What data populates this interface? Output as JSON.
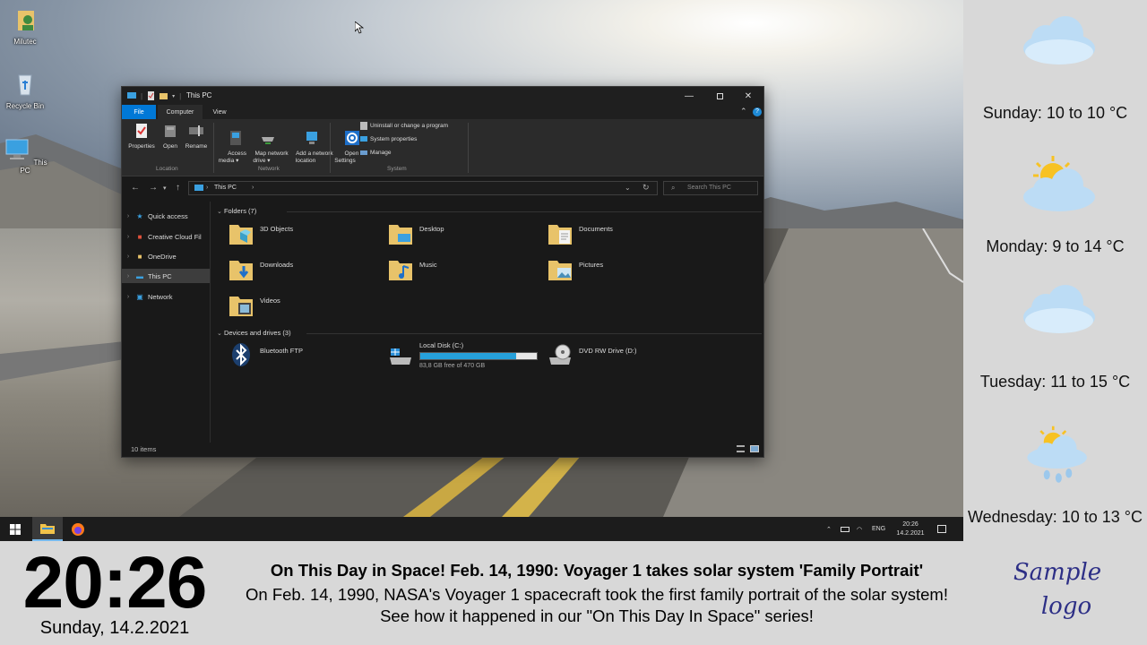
{
  "desktop": {
    "icons": [
      {
        "label": "Milutec",
        "icon": "user-folder-icon"
      },
      {
        "label": "Recycle Bin",
        "icon": "recycle-bin-icon"
      },
      {
        "label": "This PC",
        "icon": "computer-icon"
      }
    ]
  },
  "explorer": {
    "title": "This PC",
    "tabs": [
      "File",
      "Computer",
      "View"
    ],
    "ribbon": {
      "location": {
        "label": "Location",
        "buttons": [
          "Properties",
          "Open",
          "Rename"
        ]
      },
      "network": {
        "label": "Network",
        "buttons": [
          "Access\nmedia ▾",
          "Map network\ndrive ▾",
          "Add a network\nlocation"
        ]
      },
      "system": {
        "label": "System",
        "open_settings": "Open\nSettings",
        "small_buttons": [
          "Uninstall or change a program",
          "System properties",
          "Manage"
        ]
      }
    },
    "address": {
      "crumb": "This PC",
      "separator": "›",
      "search_placeholder": "Search This PC"
    },
    "nav": {
      "items": [
        "Quick access",
        "Creative Cloud Fil",
        "OneDrive",
        "This PC",
        "Network"
      ],
      "selected": "This PC"
    },
    "folders": {
      "header": "Folders (7)",
      "items": [
        "3D Objects",
        "Desktop",
        "Documents",
        "Downloads",
        "Music",
        "Pictures",
        "Videos"
      ]
    },
    "devices": {
      "header": "Devices and drives (3)",
      "items": [
        {
          "name": "Bluetooth FTP"
        },
        {
          "name": "Local Disk (C:)",
          "detail": "83,8 GB free of 470 GB",
          "used_fraction": 0.82
        },
        {
          "name": "DVD RW Drive (D:)"
        }
      ]
    },
    "status": "10 items"
  },
  "taskbar": {
    "lang": "ENG",
    "time": "20:26",
    "date": "14.2.2021"
  },
  "weather": [
    {
      "label": "Sunday: 10 to 10 °C",
      "icon": "cloud-icon"
    },
    {
      "label": "Monday: 9 to 14 °C",
      "icon": "sun-cloud-icon"
    },
    {
      "label": "Tuesday: 11 to 15 °C",
      "icon": "cloud-icon"
    },
    {
      "label": "Wednesday: 10 to 13 °C",
      "icon": "sun-rain-cloud-icon"
    }
  ],
  "clock": {
    "time": "20:26",
    "date": "Sunday, 14.2.2021"
  },
  "news": {
    "title": "On This Day in Space! Feb. 14, 1990: Voyager 1 takes solar system 'Family Portrait'",
    "body": "On Feb. 14, 1990, NASA's Voyager 1 spacecraft took the first family portrait of the solar system! See how it happened in our \"On This Day In Space\" series!"
  },
  "logo": {
    "line1": "Sample",
    "line2": "logo"
  },
  "colors": {
    "accent": "#0078d7",
    "drive_bar": "#26a0da",
    "logo": "#2d2f86"
  }
}
